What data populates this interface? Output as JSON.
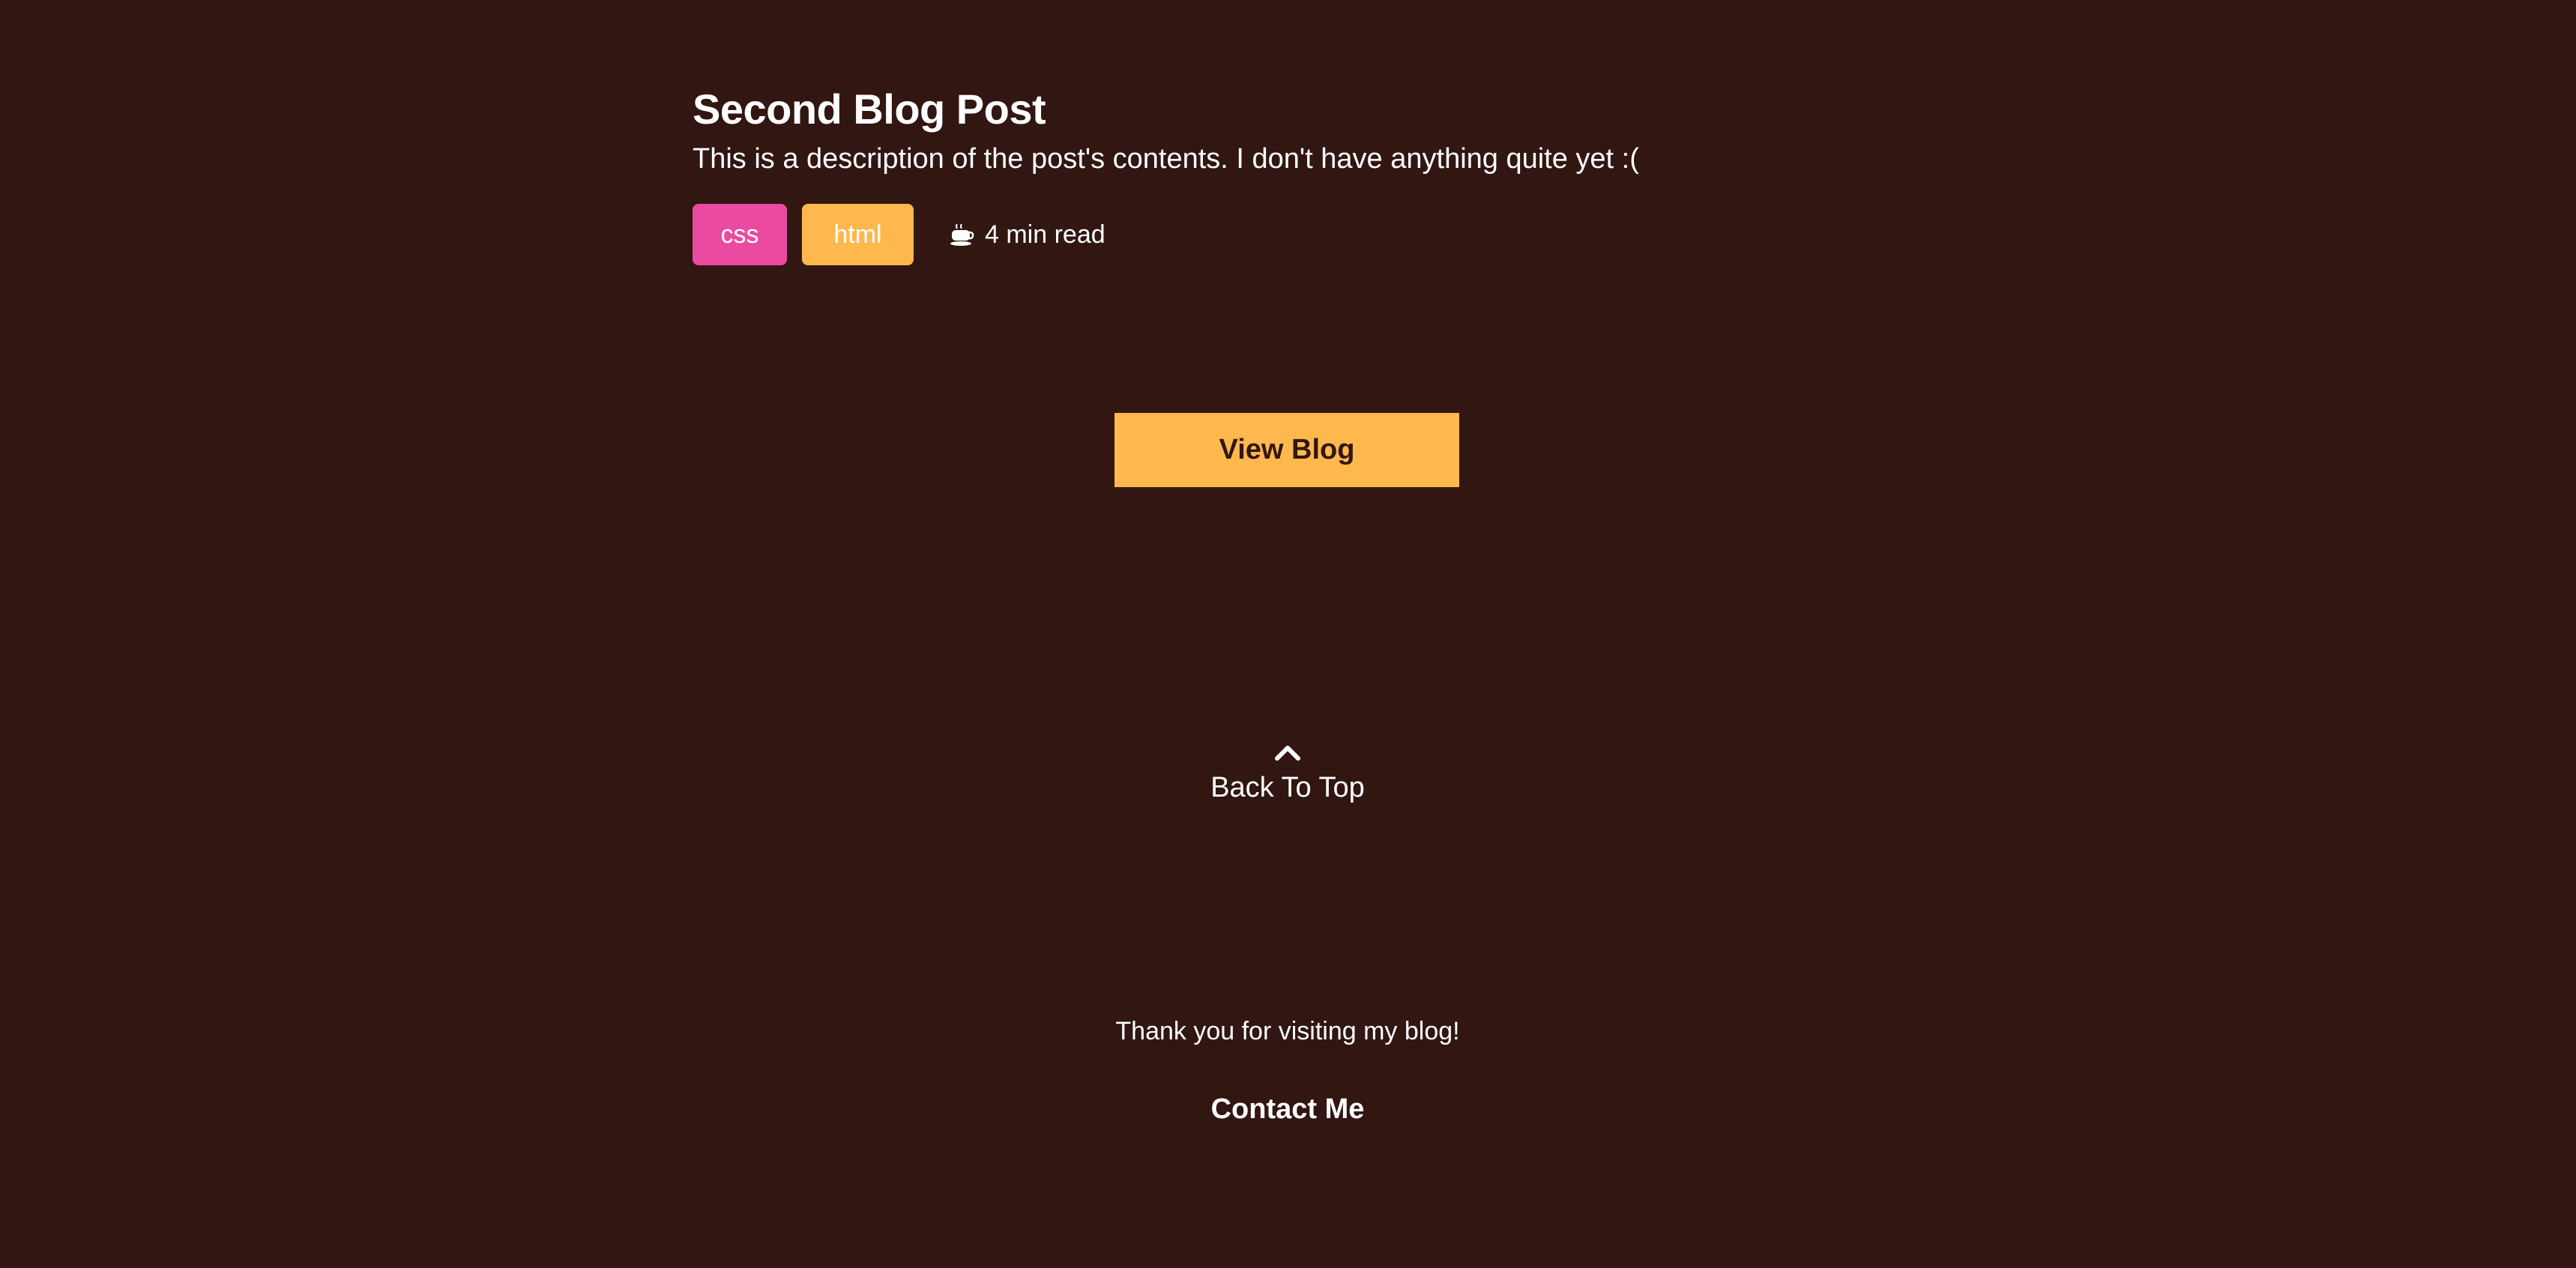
{
  "post": {
    "title": "Second Blog Post",
    "description": "This is a description of the post's contents. I don't have anything quite yet :(",
    "tags": [
      {
        "label": "css",
        "color": "#ea4aa0"
      },
      {
        "label": "html",
        "color": "#ffb84d"
      }
    ],
    "read_time_icon": "coffee-cup-icon",
    "read_time": "4 min read"
  },
  "view_blog_label": "View Blog",
  "back_to_top": {
    "icon": "chevron-up-icon",
    "label": "Back To Top"
  },
  "footer": {
    "thanks": "Thank you for visiting my blog!",
    "contact_label": "Contact Me"
  },
  "colors": {
    "background": "#311612",
    "accent": "#ffb84d",
    "pink": "#ea4aa0",
    "text": "#ffffff"
  }
}
